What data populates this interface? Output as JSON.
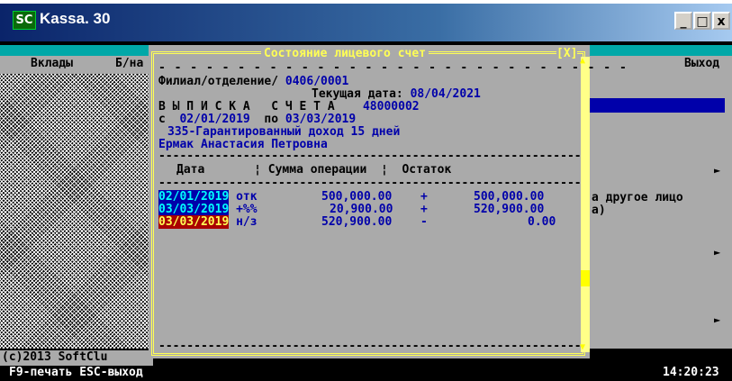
{
  "window": {
    "title": "Kassa. 30",
    "icon_label": "SC",
    "minimize": "_",
    "maximize": "□",
    "close": "x"
  },
  "menubar": {
    "left": "Вклады",
    "second": "Б/на",
    "right": "Выход"
  },
  "dialog": {
    "title": "Состояние лицевого счет",
    "close": "[X]",
    "branch_label": "Филиал/отделение/",
    "branch_value": "0406/0001",
    "date_label": "Текущая дата:",
    "date_value": "08/04/2021",
    "statement_label": "В Ы П И С К А   С Ч Е Т А",
    "account_number": "48000002",
    "period_from_label": "с",
    "period_from": "02/01/2019",
    "period_to_label": "по",
    "period_to": "03/03/2019",
    "product": "335-Гарантированный доход 15 дней",
    "client": "Ермак Анастасия Петровна",
    "columns": {
      "date": "Дата",
      "sep1": "¦",
      "amount": "Сумма операции",
      "sep2": "¦",
      "balance": "Остаток"
    },
    "rows": [
      {
        "date": "02/01/2019",
        "code": "отк",
        "amount": "500,000.00",
        "sign": "+",
        "balance": "500,000.00"
      },
      {
        "date": "03/03/2019",
        "code": "+%%",
        "amount": "20,900.00",
        "sign": "+",
        "balance": "520,900.00"
      },
      {
        "date": "03/03/2019",
        "code": "н/з",
        "amount": "520,900.00",
        "sign": "-",
        "balance": "0.00"
      }
    ],
    "dashes": "- - - - - - - - - - - - - - - - - - - - - - - - - - - - - -",
    "rule": "------------------------------------------------------------"
  },
  "right_panel": {
    "line1": "а другое лицо",
    "line2": "а)",
    "arrow": "►"
  },
  "footer": {
    "copyright": "(c)2013 SoftClu",
    "hint": "F9-печать ESC-выход",
    "clock": "14:20:23"
  },
  "colors": {
    "dialog_bg": "#aaaaaa",
    "border": "#ffff55",
    "title_blue": "#0a246a",
    "highlight_blue": "#0000aa",
    "highlight_red": "#aa0000"
  }
}
